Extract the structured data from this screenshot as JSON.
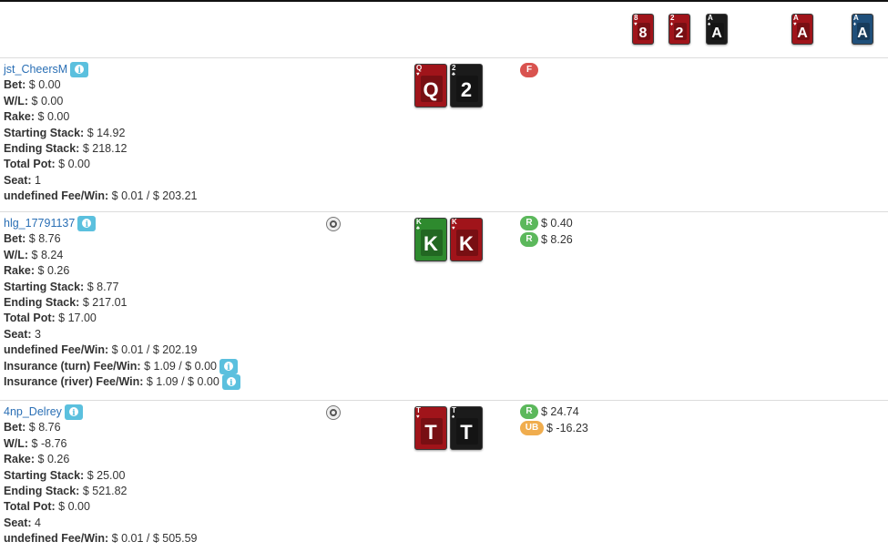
{
  "board": [
    {
      "rank": "8",
      "color": "red"
    },
    {
      "rank": "2",
      "color": "red"
    },
    {
      "rank": "A",
      "color": "black"
    },
    {
      "rank": "A",
      "color": "red"
    },
    {
      "rank": "A",
      "color": "blue"
    }
  ],
  "players": [
    {
      "name": "jst_CheersM",
      "rows": [
        {
          "label": "Bet:",
          "value": " $ 0.00"
        },
        {
          "label": "W/L:",
          "value": " $ 0.00"
        },
        {
          "label": "Rake:",
          "value": " $ 0.00"
        },
        {
          "label": "Starting Stack:",
          "value": " $ 14.92"
        },
        {
          "label": "Ending Stack:",
          "value": " $ 218.12"
        },
        {
          "label": "Total Pot:",
          "value": " $ 0.00"
        },
        {
          "label": "Seat:",
          "value": " 1"
        },
        {
          "label": "undefined Fee/Win:",
          "value": " $ 0.01 / $ 203.21"
        }
      ],
      "cards": [
        {
          "rank": "Q",
          "color": "red"
        },
        {
          "rank": "2",
          "color": "black"
        }
      ],
      "actions": [
        {
          "badge": "F",
          "amount": ""
        }
      ]
    },
    {
      "name": "hlg_17791137",
      "rows": [
        {
          "label": "Bet:",
          "value": " $ 8.76"
        },
        {
          "label": "W/L:",
          "value": " $ 8.24"
        },
        {
          "label": "Rake:",
          "value": " $ 0.26"
        },
        {
          "label": "Starting Stack:",
          "value": " $ 8.77"
        },
        {
          "label": "Ending Stack:",
          "value": " $ 217.01"
        },
        {
          "label": "Total Pot:",
          "value": " $ 17.00"
        },
        {
          "label": "Seat:",
          "value": " 3"
        },
        {
          "label": "undefined Fee/Win:",
          "value": " $ 0.01 / $ 202.19"
        },
        {
          "label": "Insurance (turn) Fee/Win:",
          "value": " $ 1.09 / $ 0.00"
        },
        {
          "label": "Insurance (river) Fee/Win:",
          "value": " $ 1.09 / $ 0.00"
        }
      ],
      "cards": [
        {
          "rank": "K",
          "color": "green"
        },
        {
          "rank": "K",
          "color": "red"
        }
      ],
      "actions": [
        {
          "badge": "R",
          "amount": "$ 0.40"
        },
        {
          "badge": "R",
          "amount": "$ 8.26"
        }
      ]
    },
    {
      "name": "4np_Delrey",
      "rows": [
        {
          "label": "Bet:",
          "value": " $ 8.76"
        },
        {
          "label": "W/L:",
          "value": " $ -8.76"
        },
        {
          "label": "Rake:",
          "value": " $ 0.26"
        },
        {
          "label": "Starting Stack:",
          "value": " $ 25.00"
        },
        {
          "label": "Ending Stack:",
          "value": " $ 521.82"
        },
        {
          "label": "Total Pot:",
          "value": " $ 0.00"
        },
        {
          "label": "Seat:",
          "value": " 4"
        },
        {
          "label": "undefined Fee/Win:",
          "value": " $ 0.01 / $ 505.59"
        }
      ],
      "cards": [
        {
          "rank": "T",
          "color": "red"
        },
        {
          "rank": "T",
          "color": "black"
        }
      ],
      "actions": [
        {
          "badge": "R",
          "amount": "$ 24.74"
        },
        {
          "badge": "UB",
          "amount": "$ -16.23"
        }
      ]
    }
  ]
}
